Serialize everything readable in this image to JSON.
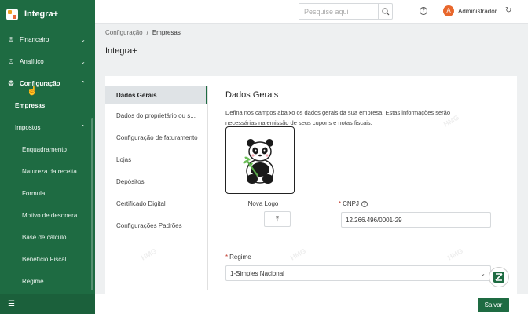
{
  "app": {
    "name": "Integra+"
  },
  "sidebar": {
    "items": [
      {
        "label": "Financeiro",
        "icon": "dollar-circle-icon"
      },
      {
        "label": "Analítico",
        "icon": "analytics-icon"
      },
      {
        "label": "Configuração",
        "icon": "gear-icon"
      }
    ],
    "sub_items": [
      {
        "label": "Empresas"
      },
      {
        "label": "Impostos"
      }
    ],
    "tax_items": [
      "Enquadramento",
      "Natureza da receita",
      "Formula",
      "Motivo de desonera...",
      "Base de cálculo",
      "Benefício Fiscal",
      "Regime"
    ],
    "footer_icon": "menu-collapse-icon"
  },
  "header": {
    "search_placeholder": "Pesquise aqui",
    "avatar_letter": "A",
    "user_name": "Administrador"
  },
  "breadcrumb": {
    "parent": "Configuração",
    "separator": "/",
    "current": "Empresas"
  },
  "page_title": "Integra+",
  "tabs": [
    "Dados Gerais",
    "Dados do proprietário ou s...",
    "Configuração de faturamento",
    "Lojas",
    "Depósitos",
    "Certificado Digital",
    "Configurações Padrões"
  ],
  "form": {
    "title": "Dados Gerais",
    "description": "Defina nos campos abaixo os dados gerais da sua empresa. Estas informações serão necessárias na emissão de seus cupons e notas fiscais.",
    "logo_label": "Nova Logo",
    "cnpj_label": "CNPJ",
    "cnpj_value": "12.266.496/0001-29",
    "regime_label": "Regime",
    "regime_value": "1-Simples Nacional",
    "required_mark": "*"
  },
  "watermark": "HMG",
  "footer": {
    "save_label": "Salvar"
  },
  "colors": {
    "primary": "#1e6b42",
    "avatar": "#e8672c",
    "required": "#c0392b"
  }
}
